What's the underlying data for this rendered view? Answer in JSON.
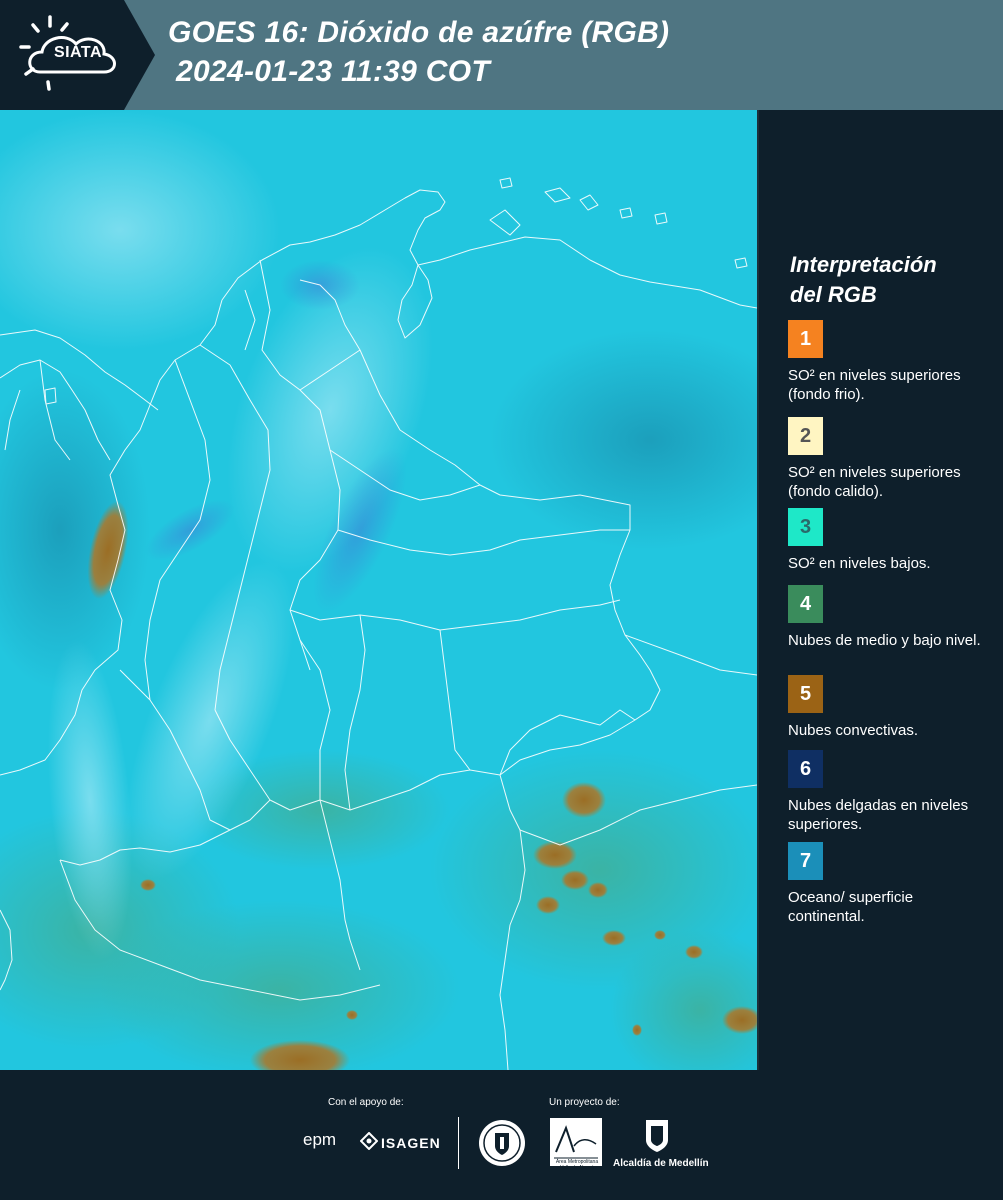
{
  "header": {
    "logo_text": "SIATA",
    "title": "GOES 16: Dióxido de azúfre (RGB)",
    "subtitle": "2024-01-23 11:39 COT"
  },
  "legend": {
    "title_line1": "Interpretación",
    "title_line2": "del RGB",
    "items": [
      {
        "number": "1",
        "label": "SO² en niveles superiores (fondo frio).",
        "color": "#f58220"
      },
      {
        "number": "2",
        "label": "SO² en niveles superiores (fondo calido).",
        "color": "#fff5c2"
      },
      {
        "number": "3",
        "label": "SO² en niveles bajos.",
        "color": "#1ee8c8"
      },
      {
        "number": "4",
        "label": "Nubes de medio y bajo nivel.",
        "color": "#3a8c5c"
      },
      {
        "number": "5",
        "label": "Nubes convectivas.",
        "color": "#9b6315"
      },
      {
        "number": "6",
        "label": "Nubes delgadas en niveles superiores.",
        "color": "#0f2f63"
      },
      {
        "number": "7",
        "label": "Oceano/ superficie continental.",
        "color": "#1b8fb9"
      }
    ]
  },
  "footer": {
    "support_label": "Con el apoyo de:",
    "project_label": "Un proyecto de:",
    "sponsor_1": "epm",
    "sponsor_2": "ISAGEN",
    "partner_1": "Área Metropolitana Valle de Aburrá",
    "partner_2": "Alcaldía de Medellín"
  },
  "map": {
    "background_color": "#23c8e0",
    "border_color": "#ffffff"
  }
}
